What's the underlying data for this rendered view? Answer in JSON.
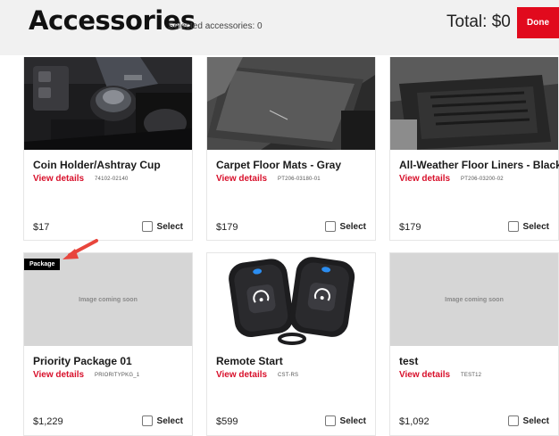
{
  "header": {
    "title": "Accessories",
    "selected_label": "Selected accessories: 0",
    "total_label": "Total: $0",
    "done_label": "Done"
  },
  "select_label": "Select",
  "details_label": "View details",
  "coming_soon_label": "Image coming soon",
  "package_badge": "Package",
  "products": [
    {
      "name": "Coin Holder/Ashtray Cup",
      "sku": "74102-02140",
      "price": "$17"
    },
    {
      "name": "Carpet Floor Mats - Gray",
      "sku": "PT206-03180-01",
      "price": "$179"
    },
    {
      "name": "All-Weather Floor Liners - Black",
      "sku": "PT206-03200-02",
      "price": "$179"
    },
    {
      "name": "Priority Package 01",
      "sku": "PRIORITYPKG_1",
      "price": "$1,229"
    },
    {
      "name": "Remote Start",
      "sku": "CST-RS",
      "price": "$599"
    },
    {
      "name": "test",
      "sku": "TEST12",
      "price": "$1,092"
    }
  ],
  "colors": {
    "accent": "#e10a1d",
    "link": "#d8102b",
    "header_bg": "#f1f1f1",
    "arrow": "#e8453c"
  },
  "icons": [
    "checkbox-icon",
    "annotation-arrow-icon",
    "key-fob-icon"
  ]
}
